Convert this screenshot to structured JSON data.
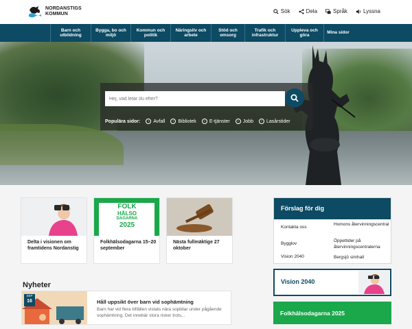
{
  "header": {
    "logo_line1": "NORDANSTIGS",
    "logo_line2": "KOMMUN",
    "tools": [
      {
        "label": "Sök",
        "icon": "search-icon"
      },
      {
        "label": "Dela",
        "icon": "share-icon"
      },
      {
        "label": "Språk",
        "icon": "language-icon"
      },
      {
        "label": "Lyssna",
        "icon": "speaker-icon"
      }
    ]
  },
  "nav": {
    "items": [
      {
        "label": "Barn och utbildning"
      },
      {
        "label": "Bygga, bo och miljö"
      },
      {
        "label": "Kommun och politik"
      },
      {
        "label": "Näringsliv och arbete"
      },
      {
        "label": "Stöd och omsorg"
      },
      {
        "label": "Trafik och infrastruktur"
      },
      {
        "label": "Uppleva och göra"
      },
      {
        "label": "Mina sidor"
      }
    ]
  },
  "search": {
    "placeholder": "Hej, vad letar du efter?",
    "popular_label": "Populära sidor:",
    "popular": [
      "Avfall",
      "Bibliotek",
      "E-tjänster",
      "Jobb",
      "Lasårstider"
    ]
  },
  "cards": [
    {
      "caption": "Delta i visionen om framtidens Nordanstig"
    },
    {
      "caption": "Folkhälsodagarna 15–20 september",
      "image_text": [
        "FOLK",
        "HÄLSO",
        "DAGARNA",
        "2025"
      ]
    },
    {
      "caption": "Nästa fullmäktige 27 oktober"
    }
  ],
  "news": {
    "heading": "Nyheter",
    "items": [
      {
        "month": "SEP",
        "day": "16",
        "title": "Håll uppsikt över barn vid sophämtning",
        "text": "Barn har vid flera tillfällen vistats nära sopbilar under pågående sophämtning. Det innebär stora risker trots..."
      }
    ]
  },
  "suggestions": {
    "heading": "Förslag för dig",
    "rows": [
      [
        "Kontakta oss",
        "Homons återvinningscentral"
      ],
      [
        "Bygglov",
        "Öppettider på återvinningscentralerna"
      ],
      [
        "Vision 2040",
        "Bergsjö simhall"
      ]
    ]
  },
  "promo": {
    "vision": "Vision 2040",
    "folk": "Folkhälsodagarna 2025"
  },
  "colors": {
    "brand": "#0d4a63",
    "green": "#1aa84b"
  }
}
